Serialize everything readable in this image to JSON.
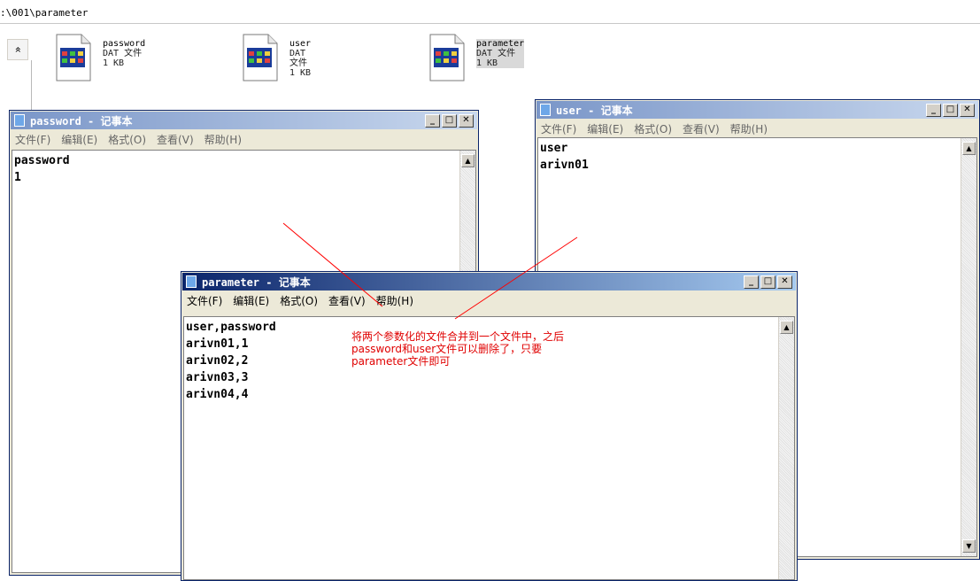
{
  "address_path": ":\\001\\parameter",
  "collapse_glyph": "»",
  "files": [
    {
      "name": "password",
      "type": "DAT 文件",
      "size": "1 KB",
      "selected": false
    },
    {
      "name": "user",
      "type": "DAT 文件",
      "size": "1 KB",
      "selected": false
    },
    {
      "name": "parameter",
      "type": "DAT 文件",
      "size": "1 KB",
      "selected": true
    }
  ],
  "menu": {
    "file": "文件(F)",
    "edit": "编辑(E)",
    "format": "格式(O)",
    "view": "查看(V)",
    "help": "帮助(H)"
  },
  "window_controls": {
    "minimize": "_",
    "maximize": "□",
    "close": "✕"
  },
  "windows": {
    "password": {
      "title": "password - 记事本",
      "content": "password\n1"
    },
    "user": {
      "title": "user - 记事本",
      "content": "user\narivn01"
    },
    "parameter": {
      "title": "parameter - 记事本",
      "content": "user,password\narivn01,1\narivn02,2\narivn03,3\narivn04,4"
    }
  },
  "annotation": "将两个参数化的文件合并到一个文件中，之后password和user文件可以删除了，只要parameter文件即可",
  "colors": {
    "annotation": "#e00000",
    "titlebar_active": "#0a246a",
    "titlebar_gradient_end": "#a6caf0"
  }
}
